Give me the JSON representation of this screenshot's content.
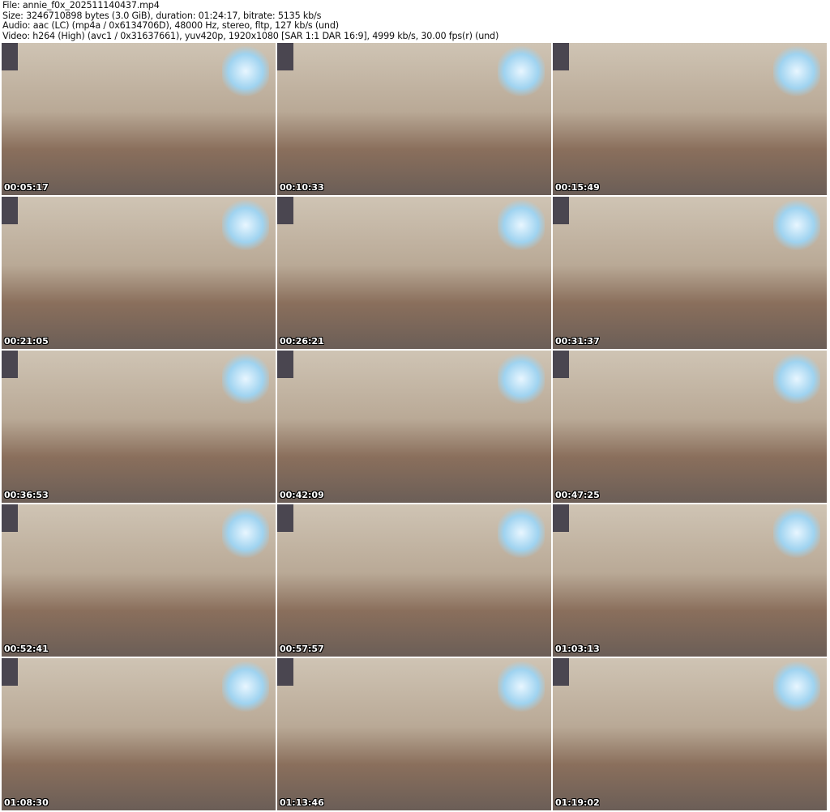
{
  "header": {
    "file": "File: annie_f0x_202511140437.mp4",
    "size": "Size: 3246710898 bytes (3.0 GiB), duration: 01:24:17, bitrate: 5135 kb/s",
    "audio": "Audio: aac (LC) (mp4a / 0x6134706D), 48000 Hz, stereo, fltp, 127 kb/s (und)",
    "video": "Video: h264 (High) (avc1 / 0x31637661), yuv420p, 1920x1080 [SAR 1:1 DAR 16:9], 4999 kb/s, 30.00 fps(r) (und)"
  },
  "thumbnails": [
    {
      "timestamp": "00:05:17"
    },
    {
      "timestamp": "00:10:33"
    },
    {
      "timestamp": "00:15:49"
    },
    {
      "timestamp": "00:21:05"
    },
    {
      "timestamp": "00:26:21"
    },
    {
      "timestamp": "00:31:37"
    },
    {
      "timestamp": "00:36:53"
    },
    {
      "timestamp": "00:42:09"
    },
    {
      "timestamp": "00:47:25"
    },
    {
      "timestamp": "00:52:41"
    },
    {
      "timestamp": "00:57:57"
    },
    {
      "timestamp": "01:03:13"
    },
    {
      "timestamp": "01:08:30"
    },
    {
      "timestamp": "01:13:46"
    },
    {
      "timestamp": "01:19:02"
    }
  ]
}
